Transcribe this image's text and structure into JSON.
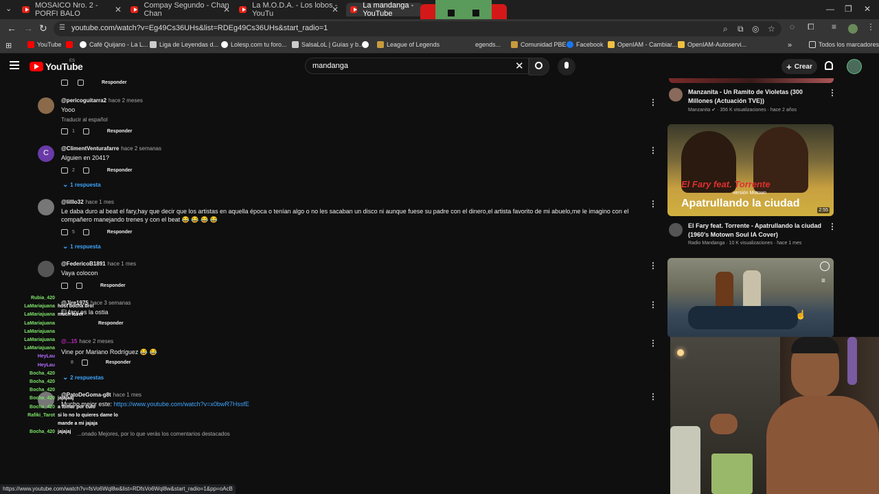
{
  "browser": {
    "tabs": [
      {
        "title": "MOSAICO Nro. 2 - PORFI BALO"
      },
      {
        "title": "Compay Segundo - Chan Chan"
      },
      {
        "title": "La M.O.D.A. - Los lobos - YouTu"
      },
      {
        "title": "La mandanga - YouTube"
      }
    ],
    "url": "youtube.com/watch?v=Eg49Cs36UHs&list=RDEg49Cs36UHs&start_radio=1",
    "bookmarks": [
      {
        "label": "YouTube",
        "color": "#ff0000"
      },
      {
        "label": "",
        "color": "#ff0000"
      },
      {
        "label": "Café Quijano - La L...",
        "color": "#ffffff"
      },
      {
        "label": "Liga de Leyendas d...",
        "color": "#cccccc"
      },
      {
        "label": "Lolesp.com tu foro...",
        "color": "#ffffff"
      },
      {
        "label": "SalsaLoL | Guías y b...",
        "color": "#cccccc"
      },
      {
        "label": "",
        "color": "#ffffff"
      },
      {
        "label": "League of Legends",
        "color": "#c89b3c"
      },
      {
        "label": "egends...",
        "color": "#c89b3c"
      },
      {
        "label": "Comunidad PBE",
        "color": "#c89b3c"
      },
      {
        "label": "Facebook",
        "color": "#1877f2"
      },
      {
        "label": "OpenIAM - Cambiar...",
        "color": "#f0c040"
      },
      {
        "label": "OpenIAM-Autoservi...",
        "color": "#f0c040"
      }
    ],
    "all_bookmarks": "Todos los marcadores",
    "status_url": "https://www.youtube.com/watch?v=fsVo6Wql8w&list=RDfsVo6Wql8w&start_radio=1&pp=oAcB"
  },
  "youtube": {
    "logo_text": "YouTube",
    "country": "ES",
    "search_query": "mandanga",
    "create_label": "Crear"
  },
  "comments": [
    {
      "author": "",
      "when": "",
      "text": "",
      "likes": "",
      "reply": "Responder"
    },
    {
      "author": "@pericoguitarra2",
      "when": "hace 2 meses",
      "text": "Yooo",
      "translate": "Traducir al español",
      "likes": "1",
      "reply": "Responder"
    },
    {
      "author": "@ClimentVenturafarre",
      "when": "hace 2 semanas",
      "text": "Alguien en 2041?",
      "likes": "2",
      "reply": "Responder",
      "replies": "1 respuesta"
    },
    {
      "author": "@lilllo32",
      "when": "hace 1 mes",
      "text": "Le daba duro al beat el fary,hay que decir que los artistas en aquella época o tenían algo o no les sacaban un disco ni aunque fuese su padre con el dinero,el artista favorito de mi abuelo,me le imagino con el compañero manejando trenes y con el beat 😂 😂 😂 😂",
      "likes": "5",
      "reply": "Responder",
      "replies": "1 respuesta"
    },
    {
      "author": "@FedericoB1891",
      "when": "hace 1 mes",
      "text": "Vaya colocon",
      "likes": "",
      "reply": "Responder"
    },
    {
      "author": "@Jire1975",
      "when": "hace 3 semanas",
      "text": "El fary es la ostia",
      "likes": "",
      "reply": "Responder"
    },
    {
      "author": "@...15",
      "when": "hace 2 meses",
      "text": "Vine por Mariano Rodríguez 😂 😂",
      "likes": "8",
      "reply": "Responder",
      "replies": "2 respuestas"
    },
    {
      "author": "@PatoDeGoma-g8t",
      "when": "hace 1 mes",
      "text_prefix": "Mucho mejor este: ",
      "link": "https://www.youtube.com/watch?v=x0bwR7HssfE"
    }
  ],
  "footer_note": "...onado Mejores, por lo que verás los comentarios destacados",
  "chat": [
    {
      "user": "Rubia_420",
      "msg": "",
      "color": "#7ee36a"
    },
    {
      "user": "LaMariajuana",
      "msg": "host bocha bro!",
      "color": "#7ee36a"
    },
    {
      "user": "LaMariajuana",
      "msg": "much lover",
      "color": "#7ee36a"
    },
    {
      "user": "LaMariajuana",
      "msg": "",
      "color": "#7ee36a"
    },
    {
      "user": "LaMariajuana",
      "msg": "",
      "color": "#7ee36a"
    },
    {
      "user": "LaMariajuana",
      "msg": "",
      "color": "#7ee36a"
    },
    {
      "user": "LaMariajuana",
      "msg": "",
      "color": "#7ee36a"
    },
    {
      "user": "HeyLau",
      "msg": "",
      "color": "#b36bff"
    },
    {
      "user": "HeyLau",
      "msg": "",
      "color": "#b36bff"
    },
    {
      "user": "Bocha_420",
      "msg": "",
      "color": "#7ee36a"
    },
    {
      "user": "Bocha_420",
      "msg": "",
      "color": "#7ee36a"
    },
    {
      "user": "Bocha_420",
      "msg": "",
      "color": "#7ee36a"
    },
    {
      "user": "Bocha_420",
      "msg": "jajajaaj",
      "color": "#7ee36a"
    },
    {
      "user": "Bocha_420",
      "msg": "a tomar por culo",
      "color": "#7ee36a"
    },
    {
      "user": "Rafiki_Tarot",
      "msg": "si lo no lo quieres dame lo",
      "color": "#7ee36a"
    },
    {
      "user": "",
      "msg": "mande a mi jajaja",
      "color": "#7ee36a"
    },
    {
      "user": "Bocha_420",
      "msg": "jajajaj",
      "color": "#7ee36a"
    }
  ],
  "sidebar": [
    {
      "title": "Manzanita - Un Ramito de Violetas (300 Millones (Actuación TVE))",
      "channel": "Manzanita",
      "meta": "356 K visualizaciones · hace 2 años"
    },
    {
      "title": "El Fary feat. Torrente - Apatrullando la ciudad (1960's Motown Soul IA Cover)",
      "channel": "Radio Mandanga",
      "meta": "10 K visualizaciones · hace 1 mes",
      "duration": "2:55",
      "thumb_line1": "El Fary feat. Torrente",
      "thumb_line2": "versión Motown",
      "thumb_line3": "Apatrullando la ciudad"
    },
    {
      "title": "",
      "channel": "",
      "meta": ""
    }
  ]
}
